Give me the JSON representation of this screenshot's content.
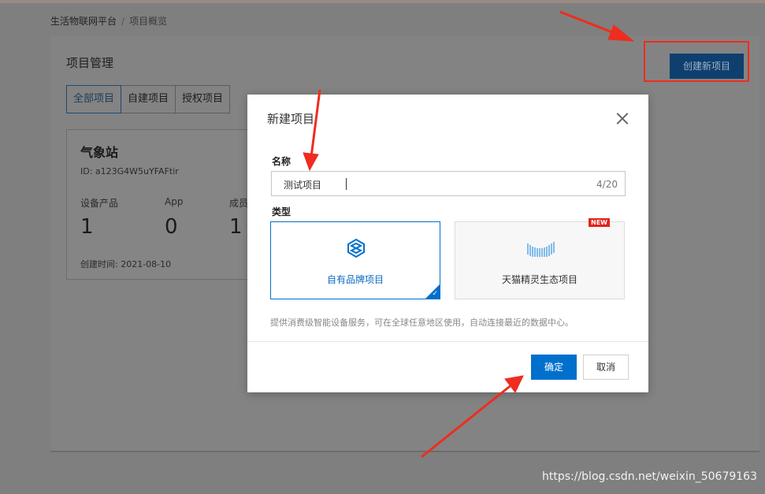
{
  "breadcrumb": {
    "root": "生活物联网平台",
    "separator": "/",
    "current": "项目概览"
  },
  "page": {
    "title": "项目管理",
    "create_button": "创建新项目",
    "filters": [
      {
        "label": "全部项目",
        "active": true
      },
      {
        "label": "自建项目",
        "active": false
      },
      {
        "label": "授权项目",
        "active": false
      }
    ]
  },
  "project_card": {
    "name": "气象站",
    "id_text": "ID: a123G4W5uYFAFtir",
    "stats": [
      {
        "label": "设备产品",
        "value": "1"
      },
      {
        "label": "App",
        "value": "0"
      },
      {
        "label": "成员",
        "value": "1"
      }
    ],
    "created": "创建时间: 2021-08-10"
  },
  "modal": {
    "title": "新建项目",
    "name_label": "名称",
    "name_value": "测试项目",
    "name_counter": "4/20",
    "type_label": "类型",
    "types": [
      {
        "label": "自有品牌项目",
        "selected": true,
        "icon": "cube-icon"
      },
      {
        "label": "天猫精灵生态项目",
        "selected": false,
        "icon": "tmall-genie-icon",
        "badge": "NEW"
      }
    ],
    "description": "提供消费级智能设备服务，可在全球任意地区使用，自动连接最近的数据中心。",
    "ok_label": "确定",
    "cancel_label": "取消"
  },
  "watermark": "https://blog.csdn.net/weixin_50679163",
  "colors": {
    "primary": "#0070cc",
    "annotation_red": "#ee2d1f",
    "badge_red": "#e2231a"
  }
}
